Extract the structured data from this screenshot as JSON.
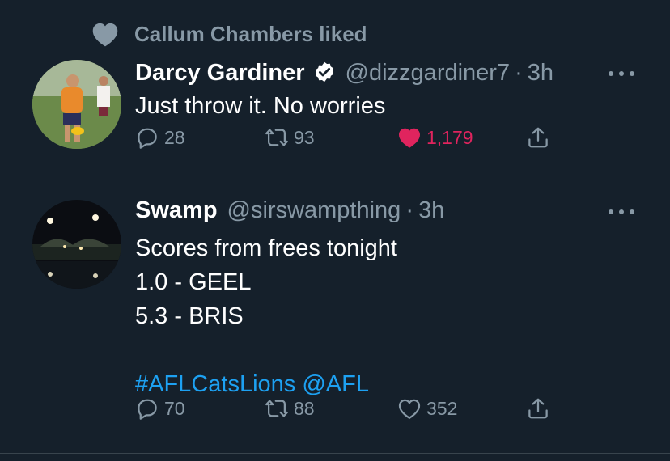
{
  "tweets": [
    {
      "social_context": "Callum Chambers liked",
      "name": "Darcy Gardiner",
      "handle": "@dizzgardiner7",
      "dot": "·",
      "time": "3h",
      "text": "Just throw it. No worries",
      "replies": "28",
      "retweets": "93",
      "likes": "1,179",
      "liked": true,
      "accent_like": "#e0245e"
    },
    {
      "name": "Swamp",
      "handle": "@sirswampthing",
      "dot": "·",
      "time": "3h",
      "lines": [
        "Scores from frees tonight",
        "1.0 - GEEL",
        "5.3 - BRIS"
      ],
      "tags": "#AFLCatsLions @AFL",
      "replies": "70",
      "retweets": "88",
      "likes": "352",
      "liked": false,
      "link_color": "#1da1f2"
    }
  ],
  "icons": [
    "heart-icon",
    "verified-badge-icon",
    "more-icon",
    "reply-icon",
    "retweet-icon",
    "like-icon",
    "share-icon"
  ]
}
